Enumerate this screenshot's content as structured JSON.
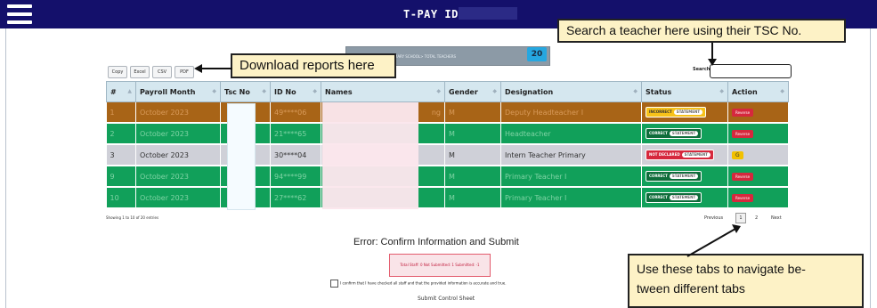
{
  "header": {
    "app_title": "T-PAY ID:"
  },
  "school_banner": {
    "text": "< NABKWENI PRIMARY SCHOOL> TOTAL TEACHERS",
    "teacher_count": "20"
  },
  "export_buttons": [
    "Copy",
    "Excel",
    "CSV",
    "PDF"
  ],
  "search": {
    "label": "Search:",
    "value": ""
  },
  "callouts": {
    "download": "Download reports here",
    "search": "Search a teacher here using their TSC No.",
    "tabs_line1": "Use these tabs to navigate be-",
    "tabs_line2": "tween different tabs"
  },
  "table": {
    "columns": [
      "#",
      "Payroll Month",
      "Tsc No",
      "ID No",
      "Names",
      "Gender",
      "Designation",
      "Status",
      "Action"
    ],
    "rows": [
      {
        "num": "1",
        "month": "October 2023",
        "id": "49****06",
        "names_tail": "ng",
        "gender": "M",
        "designation": "Deputy Headteacher I",
        "status": "INCORRECT",
        "status_sub": "STATEMENT",
        "status_color": "#f7c21a",
        "action": "Reverse",
        "row_color": "brown"
      },
      {
        "num": "2",
        "month": "October 2023",
        "id": "21****65",
        "names_tail": "",
        "gender": "M",
        "designation": "Headteacher",
        "status": "CORRECT",
        "status_sub": "STATEMENT",
        "status_color": "#0f6d3b",
        "action": "Reverse",
        "row_color": "green"
      },
      {
        "num": "3",
        "month": "October 2023",
        "id": "30****04",
        "names_tail": "",
        "gender": "M",
        "designation": "Intern Teacher Primary",
        "status": "NOT DECLARED",
        "status_sub": "STATEMENT",
        "status_color": "#d6283d",
        "action": "G",
        "row_color": "grey"
      },
      {
        "num": "9",
        "month": "October 2023",
        "id": "94****99",
        "names_tail": "",
        "gender": "M",
        "designation": "Primary Teacher I",
        "status": "CORRECT",
        "status_sub": "STATEMENT",
        "status_color": "#0f6d3b",
        "action": "Reverse",
        "row_color": "green"
      },
      {
        "num": "10",
        "month": "October 2023",
        "id": "27****62",
        "names_tail": "",
        "gender": "M",
        "designation": "Primary Teacher I",
        "status": "CORRECT",
        "status_sub": "STATEMENT",
        "status_color": "#0f6d3b",
        "action": "Reverse",
        "row_color": "green"
      }
    ]
  },
  "table_info": "Showing 1 to 10 of 20 entries",
  "pagination": {
    "previous": "Previous",
    "pages": [
      "1",
      "2"
    ],
    "next": "Next"
  },
  "error": {
    "title": "Error: Confirm Information and Submit",
    "summary": "Total Staff: 0 Not Submitted: 1 Submitted: -1"
  },
  "confirm_text": "I confirm that I have checked all staff and that the provided information is accurate and true.",
  "submit_label": "Submit Control Sheet"
}
